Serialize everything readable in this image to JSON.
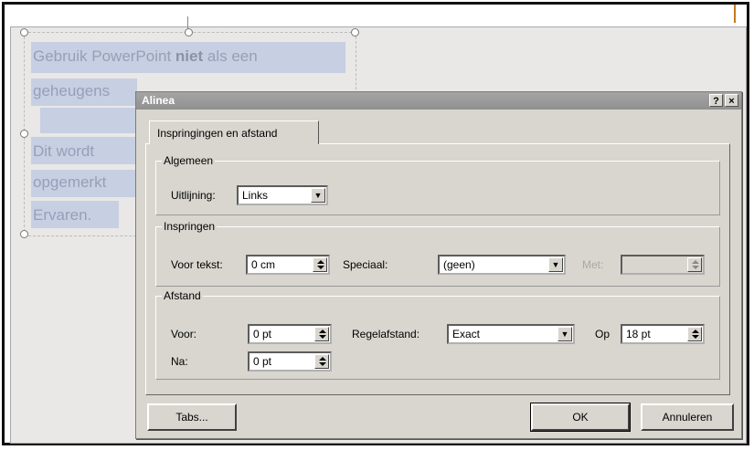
{
  "slide": {
    "lines": [
      "Gebruik PowerPoint ",
      "niet",
      " als een",
      "geheugens",
      "Dit wordt ",
      "opgemerkt",
      "Ervaren."
    ]
  },
  "dialog": {
    "title": "Alinea",
    "help_label": "?",
    "close_label": "×",
    "tab_label": "Inspringingen en afstand",
    "general": {
      "group_label": "Algemeen",
      "alignment_label": "Uitlijning:",
      "alignment_value": "Links"
    },
    "indent": {
      "group_label": "Inspringen",
      "before_text_label": "Voor tekst:",
      "before_text_value": "0 cm",
      "special_label": "Speciaal:",
      "special_value": "(geen)",
      "by_label": "Met:",
      "by_value": ""
    },
    "spacing": {
      "group_label": "Afstand",
      "before_label": "Voor:",
      "before_value": "0 pt",
      "after_label": "Na:",
      "after_value": "0 pt",
      "line_spacing_label": "Regelafstand:",
      "line_spacing_value": "Exact",
      "at_label": "Op",
      "at_value": "18 pt"
    },
    "buttons": {
      "tabs": "Tabs...",
      "ok": "OK",
      "cancel": "Annuleren"
    }
  },
  "colors": {
    "slide_text": "#95a0b8",
    "selection": "#c7cfe3",
    "dialog_face": "#d8d6cf",
    "accent_line": "#c77a1a"
  }
}
